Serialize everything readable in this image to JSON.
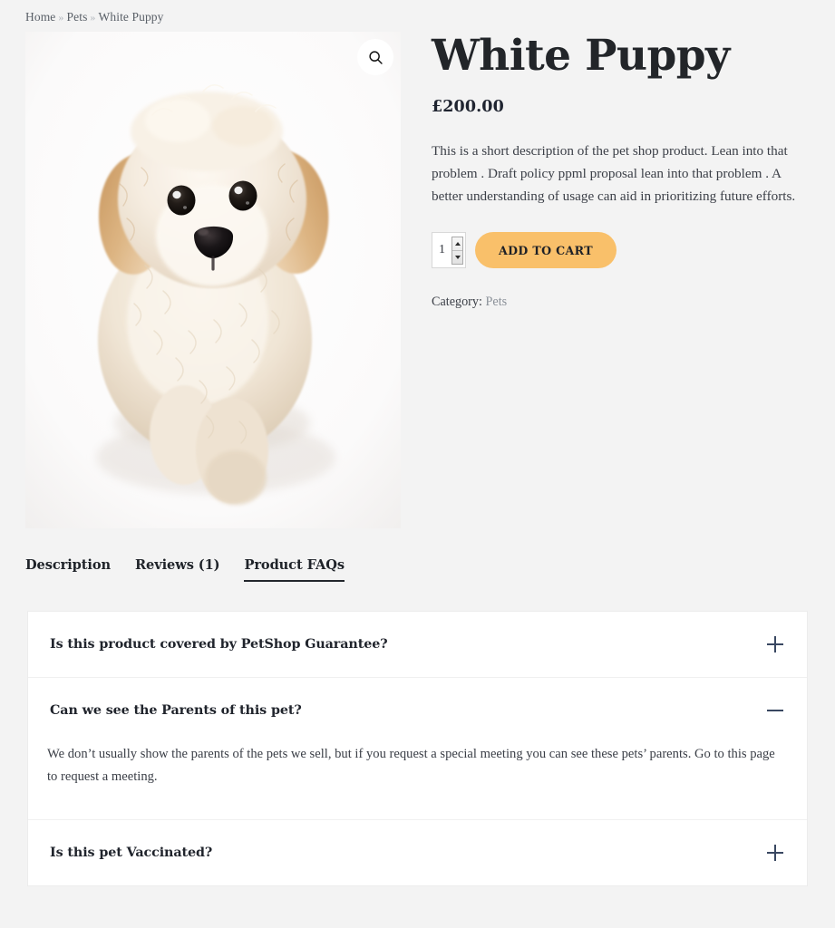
{
  "breadcrumb": {
    "items": [
      {
        "label": "Home",
        "current": false
      },
      {
        "label": "Pets",
        "current": false
      },
      {
        "label": "White Puppy",
        "current": true
      }
    ],
    "separator": "»"
  },
  "gallery": {
    "zoom_icon": "magnifier-icon",
    "image_alt": "White Puppy",
    "image_description": "Fluffy cream and apricot coloured curly-haired puppy sitting on a white background, looking up at the camera"
  },
  "product": {
    "title": "White Puppy",
    "price": "£200.00",
    "description": "This is a short description of the pet shop product. Lean into that problem . Draft policy ppml proposal lean into that problem . A better understanding of usage can aid in prioritizing future efforts.",
    "quantity": {
      "value": "1",
      "placeholder": "1",
      "increase_label": "▲",
      "decrease_label": "▼"
    },
    "add_to_cart_label": "ADD TO CART",
    "category_label": "Category:",
    "category_value": "Pets"
  },
  "tabs": [
    {
      "label": "Description",
      "active": false
    },
    {
      "label": "Reviews (1)",
      "active": false
    },
    {
      "label": "Product FAQs",
      "active": true
    }
  ],
  "faqs": [
    {
      "question": "Is this product covered by PetShop Guarantee?",
      "answer": "",
      "open": false,
      "toggle_icon": "plus-icon"
    },
    {
      "question": "Can we see the Parents of this pet?",
      "answer": "We don’t usually show the parents of the pets we sell, but if you request a special meeting you can see these pets’ parents. Go to this page to request a meeting.",
      "open": true,
      "toggle_icon": "minus-icon"
    },
    {
      "question": "Is this pet Vaccinated?",
      "answer": "",
      "open": false,
      "toggle_icon": "plus-icon"
    }
  ],
  "colors": {
    "page_background": "#f3f3f3",
    "card_background": "#ffffff",
    "accent_button": "#f9c06a",
    "text_primary": "#20242c",
    "text_muted": "#8b9199",
    "toggle_icon": "#394761"
  }
}
